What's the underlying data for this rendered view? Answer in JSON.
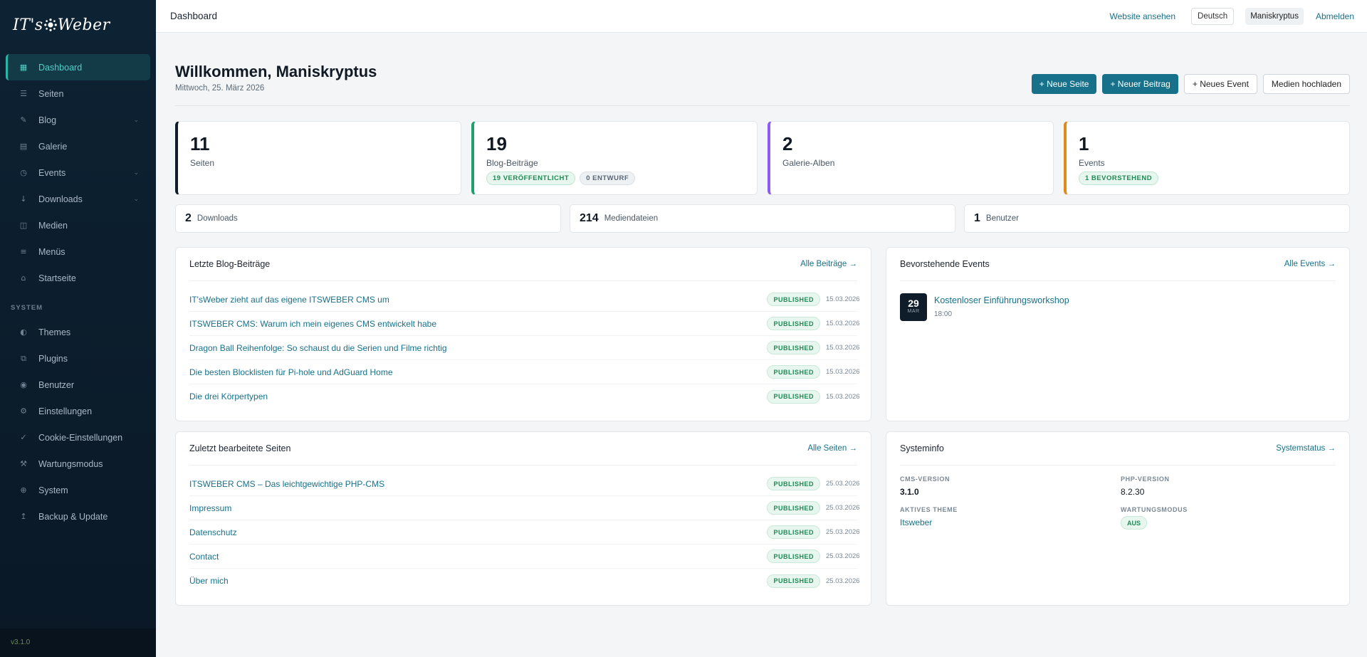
{
  "sidebar": {
    "logo": "IT's Weber",
    "items": [
      {
        "label": "Dashboard",
        "icon": "grid-icon"
      },
      {
        "label": "Seiten",
        "icon": "list-icon"
      },
      {
        "label": "Blog",
        "icon": "pen-icon"
      },
      {
        "label": "Galerie",
        "icon": "image-icon"
      },
      {
        "label": "Events",
        "icon": "clock-icon"
      },
      {
        "label": "Downloads",
        "icon": "download-icon"
      },
      {
        "label": "Medien",
        "icon": "media-icon"
      },
      {
        "label": "Menüs",
        "icon": "menu-icon"
      },
      {
        "label": "Startseite",
        "icon": "home-icon"
      }
    ],
    "section_label": "SYSTEM",
    "system_items": [
      {
        "label": "Themes",
        "icon": "theme-icon"
      },
      {
        "label": "Plugins",
        "icon": "plugin-icon"
      },
      {
        "label": "Benutzer",
        "icon": "user-icon"
      },
      {
        "label": "Einstellungen",
        "icon": "gear-icon"
      },
      {
        "label": "Cookie-Einstellungen",
        "icon": "check-icon"
      },
      {
        "label": "Wartungsmodus",
        "icon": "tools-icon"
      },
      {
        "label": "System",
        "icon": "globe-icon"
      },
      {
        "label": "Backup & Update",
        "icon": "backup-icon"
      }
    ],
    "version": "v3.1.0"
  },
  "topbar": {
    "title": "Dashboard",
    "view_site": "Website ansehen",
    "language": "Deutsch",
    "user": "Maniskryptus",
    "logout": "Abmelden"
  },
  "header": {
    "welcome": "Willkommen, Maniskryptus",
    "date": "Mittwoch, 25. März 2026",
    "actions": {
      "new_page": "+ Neue Seite",
      "new_post": "+ Neuer Beitrag",
      "new_event": "+ Neues Event",
      "upload_media": "Medien hochladen"
    }
  },
  "stats": {
    "pages": {
      "value": "11",
      "label": "Seiten",
      "color": "#0f1c2a"
    },
    "blog": {
      "value": "19",
      "label": "Blog-Beiträge",
      "color": "#1f9e6e",
      "badge_published": "19 VERÖFFENTLICHT",
      "badge_draft": "0 ENTWURF"
    },
    "gallery": {
      "value": "2",
      "label": "Galerie-Alben",
      "color": "#8b5cf6"
    },
    "events": {
      "value": "1",
      "label": "Events",
      "color": "#e08a1e",
      "badge_upcoming": "1 BEVORSTEHEND"
    }
  },
  "mini_stats": {
    "downloads": {
      "value": "2",
      "label": "Downloads"
    },
    "media": {
      "value": "214",
      "label": "Mediendateien"
    },
    "users": {
      "value": "1",
      "label": "Benutzer"
    }
  },
  "recent_posts": {
    "title": "Letzte Blog-Beiträge",
    "link": "Alle Beiträge →",
    "items": [
      {
        "title": "IT'sWeber zieht auf das eigene ITSWEBER CMS um",
        "status": "PUBLISHED",
        "date": "15.03.2026"
      },
      {
        "title": "ITSWEBER CMS: Warum ich mein eigenes CMS entwickelt habe",
        "status": "PUBLISHED",
        "date": "15.03.2026"
      },
      {
        "title": "Dragon Ball Reihenfolge: So schaust du die Serien und Filme richtig",
        "status": "PUBLISHED",
        "date": "15.03.2026"
      },
      {
        "title": "Die besten Blocklisten für Pi-hole und AdGuard Home",
        "status": "PUBLISHED",
        "date": "15.03.2026"
      },
      {
        "title": "Die drei Körpertypen",
        "status": "PUBLISHED",
        "date": "15.03.2026"
      }
    ]
  },
  "upcoming_events": {
    "title": "Bevorstehende Events",
    "link": "Alle Events →",
    "items": [
      {
        "day": "29",
        "month": "MAR",
        "title": "Kostenloser Einführungsworkshop",
        "time": "18:00"
      }
    ]
  },
  "recent_pages": {
    "title": "Zuletzt bearbeitete Seiten",
    "link": "Alle Seiten →",
    "items": [
      {
        "title": "ITSWEBER CMS – Das leichtgewichtige PHP-CMS",
        "status": "PUBLISHED",
        "date": "25.03.2026"
      },
      {
        "title": "Impressum",
        "status": "PUBLISHED",
        "date": "25.03.2026"
      },
      {
        "title": "Datenschutz",
        "status": "PUBLISHED",
        "date": "25.03.2026"
      },
      {
        "title": "Contact",
        "status": "PUBLISHED",
        "date": "25.03.2026"
      },
      {
        "title": "Über mich",
        "status": "PUBLISHED",
        "date": "25.03.2026"
      }
    ]
  },
  "system_info": {
    "title": "Systeminfo",
    "link": "Systemstatus →",
    "cms_version_label": "CMS-VERSION",
    "cms_version": "3.1.0",
    "php_version_label": "PHP-VERSION",
    "php_version": "8.2.30",
    "theme_label": "AKTIVES THEME",
    "theme": "Itsweber",
    "maintenance_label": "WARTUNGSMODUS",
    "maintenance": "AUS"
  }
}
